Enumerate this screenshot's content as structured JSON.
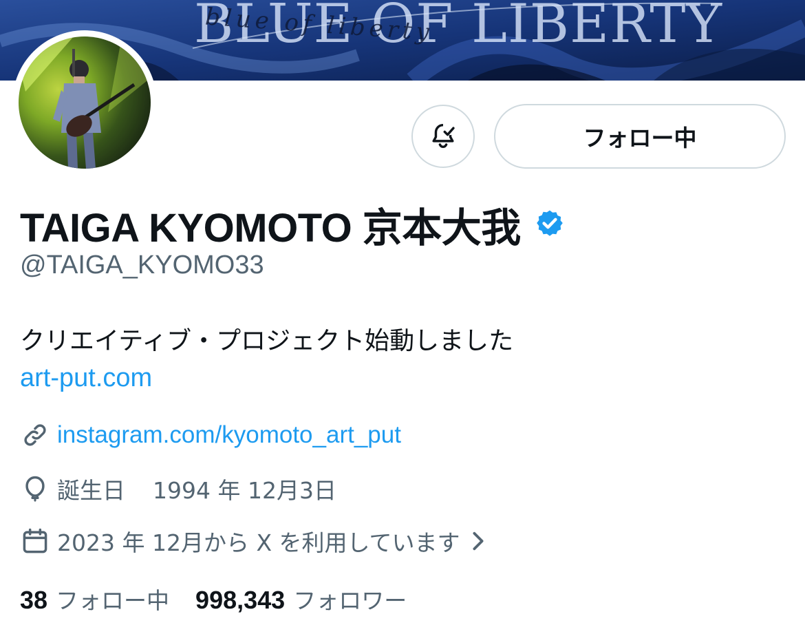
{
  "banner": {
    "title": "BLUE OF LIBERTY",
    "script_text": "blue of liberty"
  },
  "profile": {
    "display_name": "TAIGA KYOMOTO 京本大我",
    "handle": "@TAIGA_KYOMO33",
    "verified_icon": "verified-badge-icon",
    "avatar_icon": "profile-photo"
  },
  "actions": {
    "notify_icon": "bell-check-icon",
    "follow_label": "フォロー中"
  },
  "bio": {
    "text": "クリエイティブ・プロジェクト始動しました",
    "link": "art-put.com"
  },
  "meta": {
    "website": "instagram.com/kyomoto_art_put",
    "website_icon": "link-icon",
    "birthday_label": "誕生日",
    "birthday_value": "1994 年 12月3日",
    "birthday_icon": "balloon-icon",
    "joined": "2023 年 12月から X を利用しています",
    "joined_icon": "calendar-icon",
    "joined_chevron_icon": "chevron-right-icon"
  },
  "stats": {
    "following_count": "38",
    "following_label": "フォロー中",
    "followers_count": "998,343",
    "followers_label": "フォロワー"
  },
  "colors": {
    "link_blue": "#1d9bf0",
    "secondary_text": "#536471",
    "border": "#cfd9de",
    "verified_blue": "#1d9bf0"
  }
}
